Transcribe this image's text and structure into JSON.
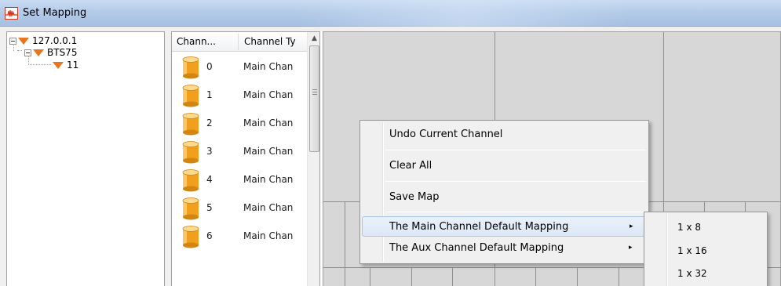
{
  "window": {
    "title": "Set Mapping",
    "icon": "waveform-icon"
  },
  "tree": {
    "nodes": [
      {
        "label": "127.0.0.1",
        "icon": "orange-triangle-icon",
        "expander": "collapse-icon"
      },
      {
        "label": "BTS75",
        "icon": "orange-triangle-icon",
        "expander": "collapse-icon"
      },
      {
        "label": "11",
        "icon": "orange-triangle-icon"
      }
    ]
  },
  "channel_list": {
    "columns": [
      "Chann...",
      "Channel Ty"
    ],
    "rows": [
      {
        "number": "0",
        "type": "Main Chan"
      },
      {
        "number": "1",
        "type": "Main Chan"
      },
      {
        "number": "2",
        "type": "Main Chan"
      },
      {
        "number": "3",
        "type": "Main Chan"
      },
      {
        "number": "4",
        "type": "Main Chan"
      },
      {
        "number": "5",
        "type": "Main Chan"
      },
      {
        "number": "6",
        "type": "Main Chan"
      }
    ],
    "row_icon": "battery-cylinder-icon"
  },
  "context_menu": {
    "items": [
      {
        "label": "Undo Current Channel"
      },
      {
        "label": "Clear All"
      },
      {
        "label": "Save Map"
      },
      {
        "label": "The Main Channel Default Mapping",
        "submenu_arrow": "▸",
        "highlighted": true
      },
      {
        "label": "The Aux Channel Default Mapping",
        "submenu_arrow": "▸"
      }
    ]
  },
  "submenu": {
    "items": [
      "1 x 8",
      "1 x 16",
      "1 x 32"
    ]
  },
  "colors": {
    "accent_orange": "#e8761e",
    "menu_highlight": "#dce8f7",
    "grid_background": "#d7d7d7"
  }
}
